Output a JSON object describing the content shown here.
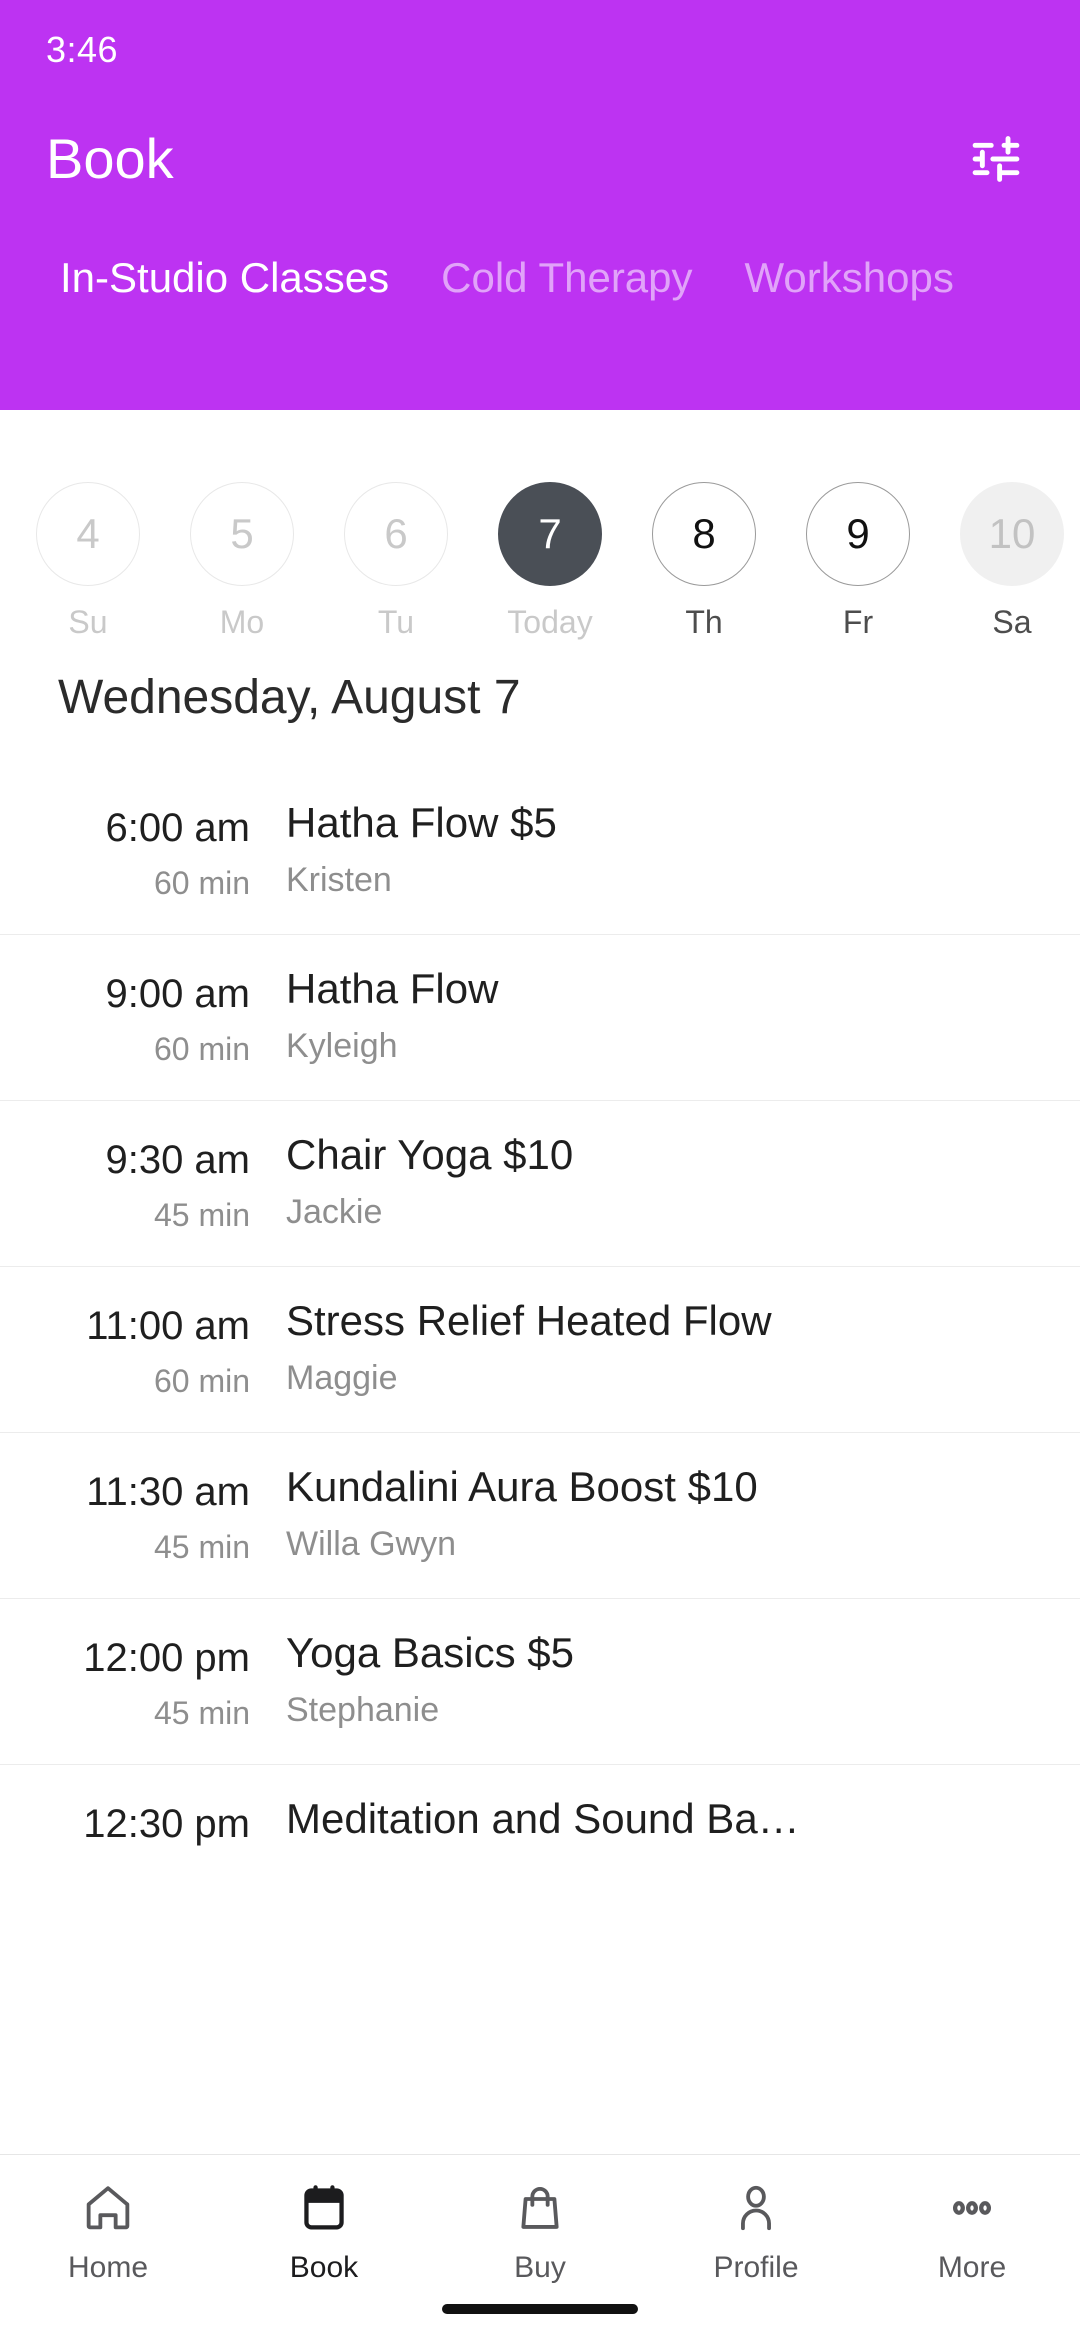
{
  "colors": {
    "brand_purple": "#bd33f2",
    "selected_day": "#4a4f56",
    "text_primary": "#1f1f1f",
    "text_muted": "#8e8e8e",
    "divider": "#ececec"
  },
  "status_bar": {
    "time": "3:46"
  },
  "app_bar": {
    "title": "Book",
    "filter_icon": "sliders-filter-icon"
  },
  "tabs": [
    {
      "label": "In-Studio Classes",
      "active": true
    },
    {
      "label": "Cold Therapy",
      "active": false
    },
    {
      "label": "Workshops",
      "active": false
    }
  ],
  "date_strip": [
    {
      "date": "4",
      "day": "Su",
      "state": "disabled"
    },
    {
      "date": "5",
      "day": "Mo",
      "state": "disabled"
    },
    {
      "date": "6",
      "day": "Tu",
      "state": "disabled"
    },
    {
      "date": "7",
      "day": "Today",
      "state": "selected"
    },
    {
      "date": "8",
      "day": "Th",
      "state": "enabled"
    },
    {
      "date": "9",
      "day": "Fr",
      "state": "enabled"
    },
    {
      "date": "10",
      "day": "Sa",
      "state": "filled"
    }
  ],
  "schedule": {
    "heading": "Wednesday, August 7",
    "classes": [
      {
        "time": "6:00 am",
        "duration": "60 min",
        "name": "Hatha Flow $5",
        "teacher": "Kristen"
      },
      {
        "time": "9:00 am",
        "duration": "60 min",
        "name": "Hatha Flow",
        "teacher": "Kyleigh"
      },
      {
        "time": "9:30 am",
        "duration": "45 min",
        "name": "Chair Yoga $10",
        "teacher": "Jackie"
      },
      {
        "time": "11:00 am",
        "duration": "60 min",
        "name": "Stress Relief Heated Flow",
        "teacher": "Maggie"
      },
      {
        "time": "11:30 am",
        "duration": "45 min",
        "name": "Kundalini Aura Boost $10",
        "teacher": "Willa Gwyn"
      },
      {
        "time": "12:00 pm",
        "duration": "45 min",
        "name": "Yoga Basics $5",
        "teacher": "Stephanie"
      },
      {
        "time": "12:30 pm",
        "duration": "",
        "name": "Meditation and Sound Ba…",
        "teacher": ""
      }
    ]
  },
  "bottom_nav": [
    {
      "label": "Home",
      "icon": "home-icon",
      "active": false
    },
    {
      "label": "Book",
      "icon": "calendar-icon",
      "active": true
    },
    {
      "label": "Buy",
      "icon": "bag-icon",
      "active": false
    },
    {
      "label": "Profile",
      "icon": "person-icon",
      "active": false
    },
    {
      "label": "More",
      "icon": "ellipsis-icon",
      "active": false
    }
  ]
}
